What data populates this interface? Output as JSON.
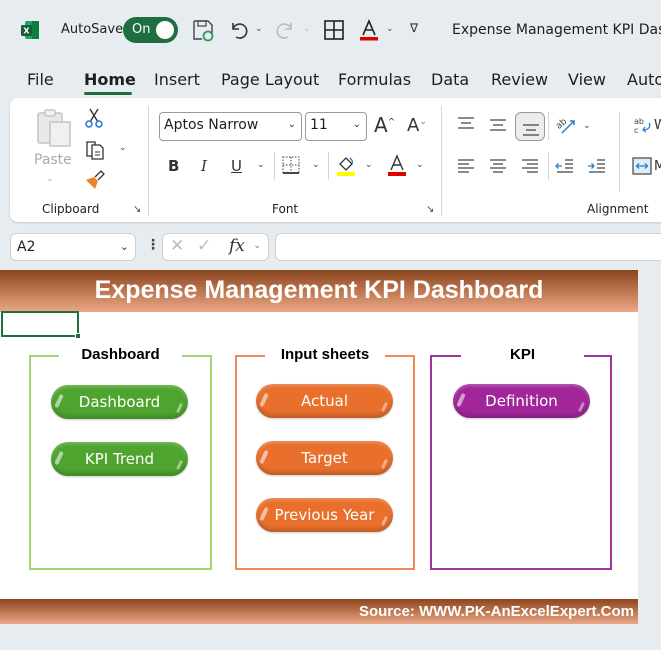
{
  "titlebar": {
    "app_icon": "excel-logo-icon",
    "autosave_label": "AutoSave",
    "autosave_state": "On",
    "document_title": "Expense Management KPI Dash",
    "qat_icons": [
      "save-icon",
      "undo-icon",
      "redo-icon",
      "borders-icon",
      "font-color-icon",
      "customize-qat-icon"
    ]
  },
  "ribbon_tabs": [
    "File",
    "Home",
    "Insert",
    "Page Layout",
    "Formulas",
    "Data",
    "Review",
    "View",
    "Auto"
  ],
  "active_tab": "Home",
  "ribbon": {
    "clipboard": {
      "label": "Clipboard",
      "paste_label": "Paste"
    },
    "font": {
      "label": "Font",
      "font_name": "Aptos Narrow",
      "font_size": "11",
      "bold": "B",
      "italic": "I",
      "underline": "U",
      "font_color_glyph": "A",
      "grow_glyph": "A",
      "shrink_glyph": "A"
    },
    "alignment": {
      "label": "Alignment",
      "wrap_partial": "W",
      "merge_partial": "M"
    }
  },
  "formula_bar": {
    "name_box": "A2",
    "fx_label": "fx",
    "formula": ""
  },
  "sheet": {
    "title": "Expense Management KPI Dashboard",
    "groups": [
      {
        "title": "Dashboard",
        "color": "#a4d46c",
        "button_color": "#4ea42f",
        "buttons": [
          "Dashboard",
          "KPI Trend"
        ]
      },
      {
        "title": "Input sheets",
        "color": "#f0895a",
        "button_color": "#e86f2c",
        "buttons": [
          "Actual",
          "Target",
          "Previous Year"
        ]
      },
      {
        "title": "KPI",
        "color": "#a0339e",
        "button_color": "#a0269a",
        "buttons": [
          "Definition"
        ]
      }
    ],
    "footer": "Source: WWW.PK-AnExcelExpert.Com"
  }
}
